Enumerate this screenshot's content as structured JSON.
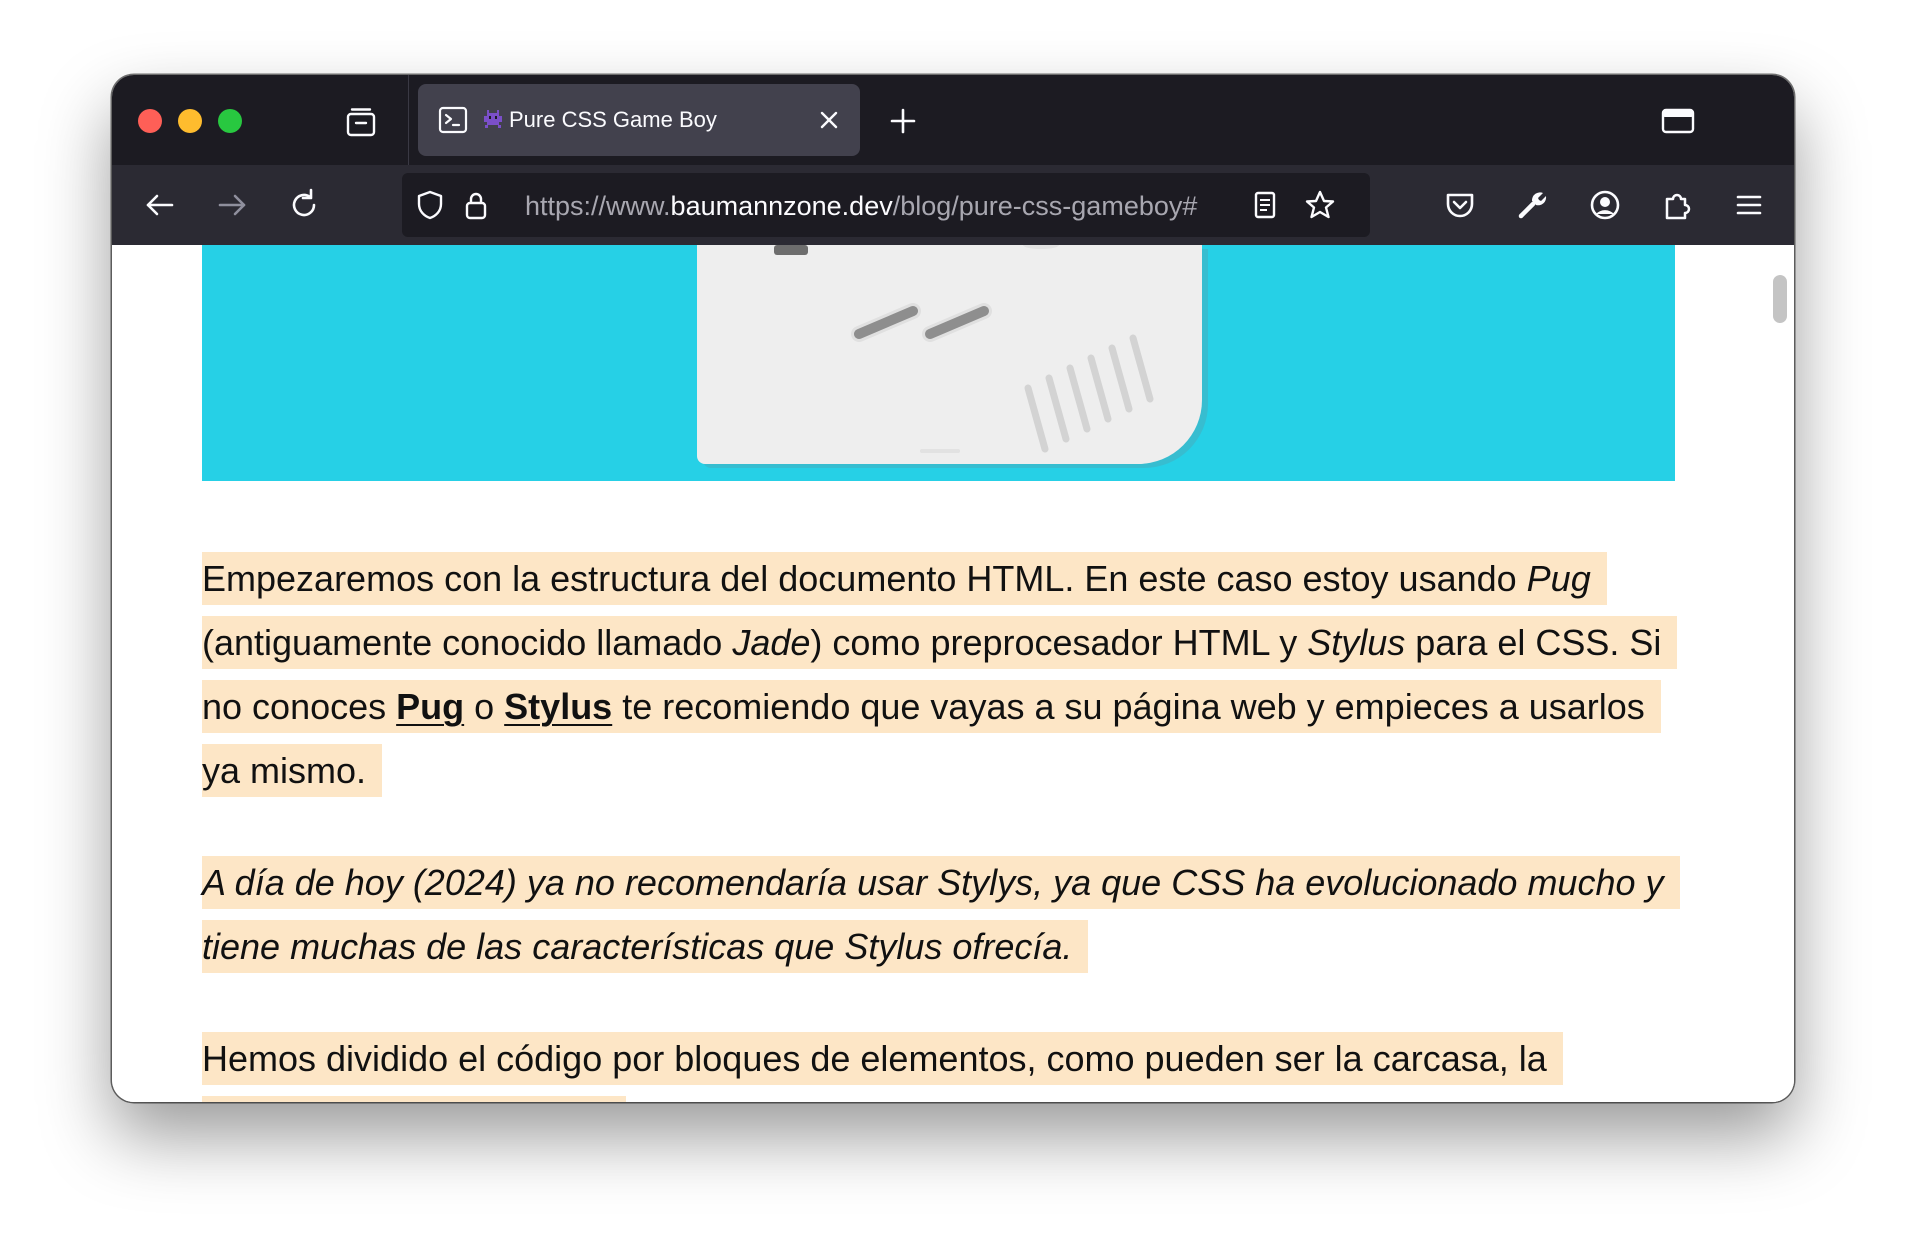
{
  "browser": {
    "tab": {
      "title": "Pure CSS Game Boy"
    },
    "url": {
      "scheme_prefix": "https://www.",
      "domain": "baumannzone.dev",
      "path": "/blog/pure-css-gameboy#"
    }
  },
  "icons": {
    "close_window": "traffic-light-red",
    "minimize_window": "traffic-light-yellow",
    "zoom_window": "traffic-light-green",
    "tab_overview": "tab-overview-icon",
    "favicon": "terminal-icon",
    "tab_emoji": "alien-monster-emoji",
    "tab_close": "close-icon",
    "new_tab": "plus-icon",
    "list_tabs": "window-icon",
    "back": "arrow-left-icon",
    "forward": "arrow-right-icon",
    "reload": "reload-icon",
    "tracking": "shield-icon",
    "secure": "lock-icon",
    "reader": "reader-view-icon",
    "bookmark": "star-icon",
    "pocket": "pocket-icon",
    "devtools": "wrench-icon",
    "account": "account-icon",
    "extensions": "puzzle-icon",
    "menu": "hamburger-menu-icon"
  },
  "colors": {
    "tabstrip_bg": "#1c1b22",
    "navbar_bg": "#2b2a33",
    "active_tab_bg": "#42414d",
    "hero_bg": "#26d0e6",
    "highlight_bg": "#fde6c6",
    "traffic_red": "#fe5f57",
    "traffic_yellow": "#febc2e",
    "traffic_green": "#28c840"
  },
  "article": {
    "p1": {
      "t1": "Empezaremos con la estructura del documento HTML. En este caso estoy usando ",
      "pug_italic": "Pug",
      "t2": " (antiguamente conocido llamado ",
      "jade_italic": "Jade",
      "t3": ") como preprocesador HTML y ",
      "stylus_italic": "Stylus",
      "t4": " para el CSS. Si no conoces ",
      "pug_link": "Pug",
      "t5": " o ",
      "stylus_link": "Stylus",
      "t6": " te recomiendo que vayas a su página web y empieces a usarlos ya mismo."
    },
    "p2": "A día de hoy (2024) ya no recomendaría usar Stylys, ya que CSS ha evolucionado mucho y tiene muchas de las características que Stylus ofrecía.",
    "p3": "Hemos dividido el código por bloques de elementos, como pueden ser la carcasa, la pantalla, los botones, etc."
  }
}
